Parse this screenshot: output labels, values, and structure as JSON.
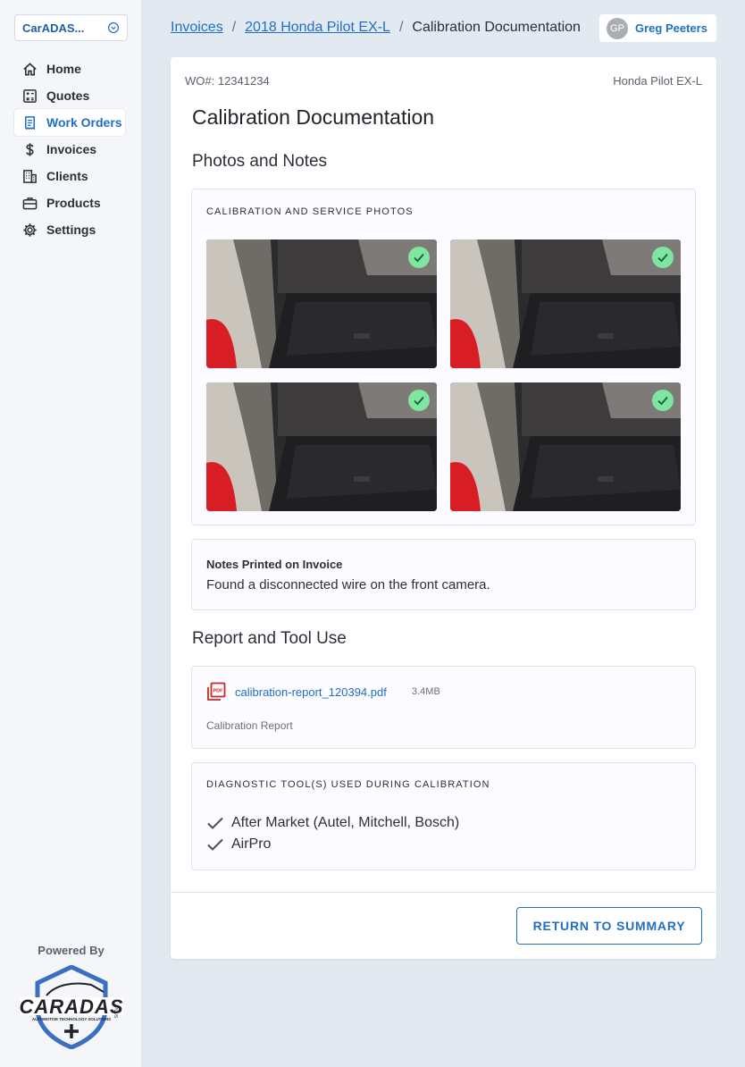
{
  "sidebar": {
    "org_label": "CarADAS...",
    "items": [
      {
        "label": "Home",
        "icon": "home-icon"
      },
      {
        "label": "Quotes",
        "icon": "calculator-icon"
      },
      {
        "label": "Work Orders",
        "icon": "receipt-icon",
        "active": true
      },
      {
        "label": "Invoices",
        "icon": "dollar-icon"
      },
      {
        "label": "Clients",
        "icon": "building-icon"
      },
      {
        "label": "Products",
        "icon": "toolbox-icon"
      },
      {
        "label": "Settings",
        "icon": "gear-icon"
      }
    ],
    "powered_by": "Powered By",
    "logo": {
      "text": "CARADAS",
      "tagline": "AUTOMOTIVE TECHNOLOGY SOLUTIONS",
      "suffix": "PLUS"
    }
  },
  "breadcrumb": {
    "items": [
      "Invoices",
      "2018 Honda Pilot EX-L"
    ],
    "separator": "/",
    "current": "Calibration Documentation"
  },
  "user": {
    "initials": "GP",
    "name": "Greg Peeters"
  },
  "main": {
    "wo_number": "WO#: 12341234",
    "vehicle": "Honda Pilot EX-L",
    "title": "Calibration Documentation",
    "photos_heading": "Photos and Notes",
    "photos_overline": "CALIBRATION AND SERVICE PHOTOS",
    "photos": [
      {
        "verified": true
      },
      {
        "verified": true
      },
      {
        "verified": true
      },
      {
        "verified": true
      }
    ],
    "notes_label": "Notes Printed on Invoice",
    "notes_text": "Found a disconnected wire on the front camera.",
    "report_heading": "Report and Tool Use",
    "report_file": "calibration-report_120394.pdf",
    "report_size": "3.4MB",
    "report_type": "Calibration Report",
    "tools_overline": "DIAGNOSTIC TOOL(S) USED DURING CALIBRATION",
    "tools": [
      "After Market (Autel, Mitchell, Bosch)",
      "AirPro"
    ],
    "return_button": "RETURN TO SUMMARY"
  },
  "colors": {
    "accent": "#1f6fc6",
    "check": "#7ee6a1",
    "page_bg": "#e3e9f1"
  }
}
